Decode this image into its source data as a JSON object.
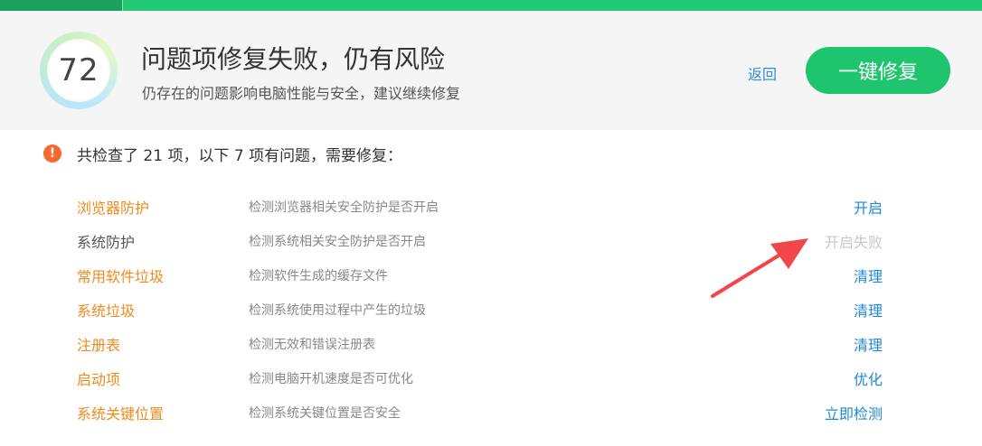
{
  "header": {
    "score": "72",
    "title": "问题项修复失败，仍有风险",
    "subtitle": "仍存在的问题影响电脑性能与安全，建议继续修复",
    "back_label": "返回",
    "fix_button_label": "一键修复"
  },
  "summary": {
    "icon": "exclamation-icon",
    "text": "共检查了 21 项，以下 7 项有问题，需要修复："
  },
  "items": [
    {
      "name": "浏览器防护",
      "desc": "检测浏览器相关安全防护是否开启",
      "action": "开启"
    },
    {
      "name": "系统防护",
      "desc": "检测系统相关安全防护是否开启",
      "action": "开启失败"
    },
    {
      "name": "常用软件垃圾",
      "desc": "检测软件生成的缓存文件",
      "action": "清理"
    },
    {
      "name": "系统垃圾",
      "desc": "检测系统使用过程中产生的垃圾",
      "action": "清理"
    },
    {
      "name": "注册表",
      "desc": "检测无效和错误注册表",
      "action": "清理"
    },
    {
      "name": "启动项",
      "desc": "检测电脑开机速度是否可优化",
      "action": "优化"
    },
    {
      "name": "系统关键位置",
      "desc": "检测系统关键位置是否安全",
      "action": "立即检测"
    }
  ],
  "colors": {
    "accent_green": "#1fc46f",
    "top_bar": "#22c974",
    "issue_orange": "#f08a1c",
    "neutral_text": "#555555",
    "action_blue": "#1d8ad6",
    "failed_gray": "#c8c8c8",
    "warning": "#f46a2e",
    "arrow_red": "#f0484a"
  }
}
